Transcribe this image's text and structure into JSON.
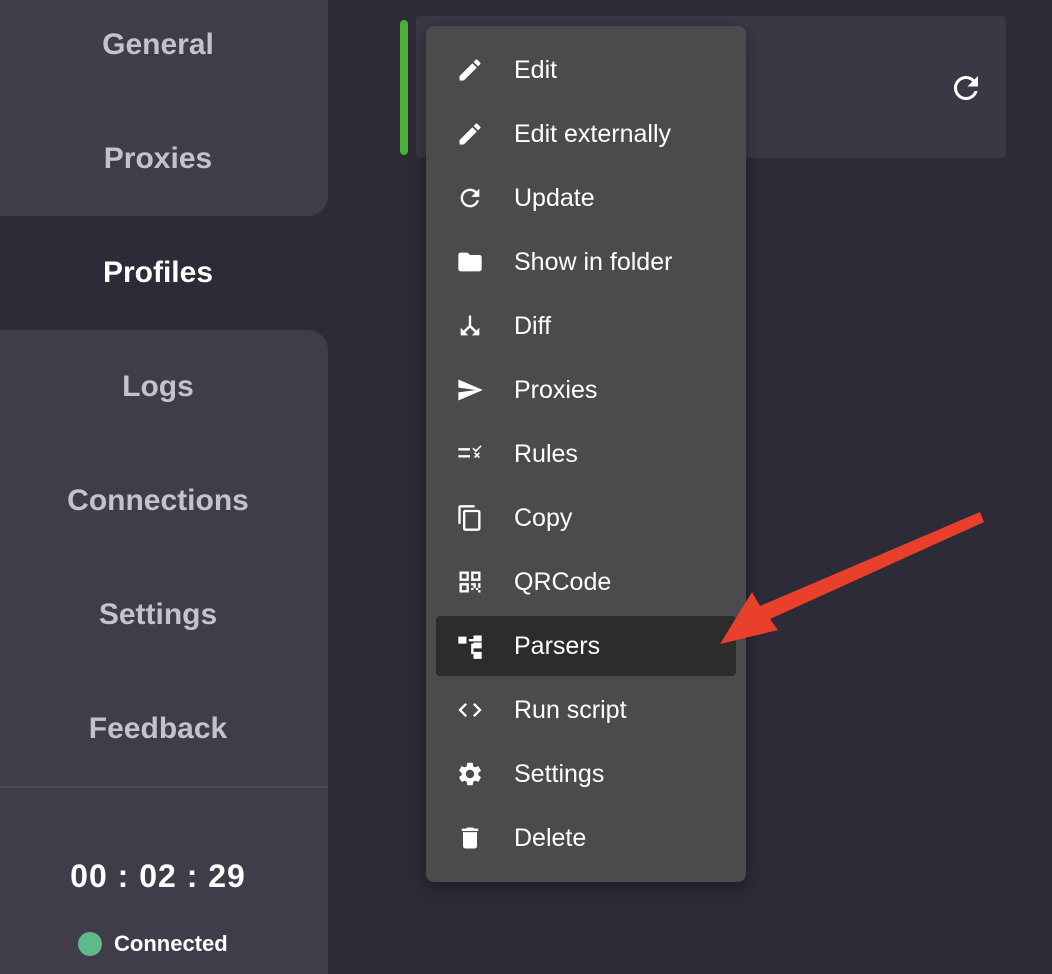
{
  "sidebar": {
    "items": [
      {
        "label": "General",
        "icon": "none"
      },
      {
        "label": "Proxies",
        "icon": "none"
      },
      {
        "label": "Profiles",
        "icon": "none",
        "active": true
      },
      {
        "label": "Logs",
        "icon": "none"
      },
      {
        "label": "Connections",
        "icon": "none"
      },
      {
        "label": "Settings",
        "icon": "none"
      },
      {
        "label": "Feedback",
        "icon": "none"
      }
    ],
    "timer": "00 : 02 : 29",
    "status": {
      "label": "Connected",
      "color": "#5dbb8a"
    }
  },
  "profile": {
    "active_color": "#4caf37",
    "refresh_icon": "refresh-icon"
  },
  "context_menu": {
    "items": [
      {
        "label": "Edit",
        "icon": "pencil-icon"
      },
      {
        "label": "Edit externally",
        "icon": "pencil-icon"
      },
      {
        "label": "Update",
        "icon": "refresh-icon"
      },
      {
        "label": "Show in folder",
        "icon": "folder-icon"
      },
      {
        "label": "Diff",
        "icon": "merge-icon"
      },
      {
        "label": "Proxies",
        "icon": "send-icon"
      },
      {
        "label": "Rules",
        "icon": "rule-icon"
      },
      {
        "label": "Copy",
        "icon": "copy-icon"
      },
      {
        "label": "QRCode",
        "icon": "qrcode-icon"
      },
      {
        "label": "Parsers",
        "icon": "parser-icon",
        "highlighted": true
      },
      {
        "label": "Run script",
        "icon": "code-icon"
      },
      {
        "label": "Settings",
        "icon": "gear-icon"
      },
      {
        "label": "Delete",
        "icon": "trash-icon"
      }
    ]
  },
  "annotation": {
    "color": "#e8402a",
    "points_to": "Parsers"
  }
}
